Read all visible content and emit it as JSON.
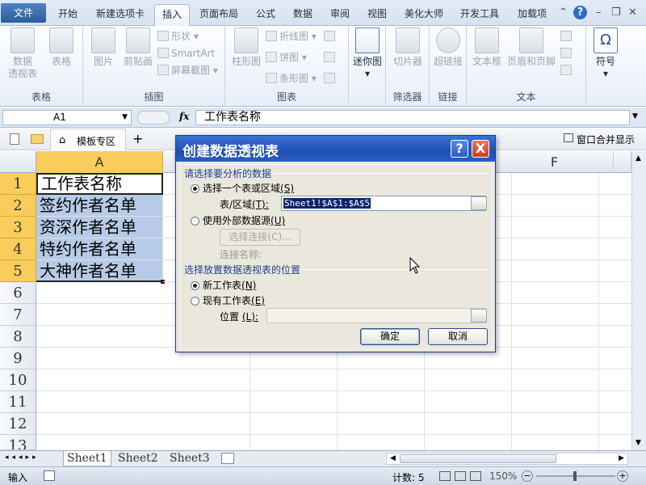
{
  "tabs": [
    "文件",
    "开始",
    "新建选项卡",
    "插入",
    "页面布局",
    "公式",
    "数据",
    "审阅",
    "视图",
    "美化大师",
    "开发工具",
    "加载项"
  ],
  "ribbon": {
    "groups": {
      "table": "表格",
      "illustrations": "插图",
      "charts": "图表",
      "sparklines": "",
      "filter": "筛选器",
      "links": "链接",
      "text": "文本"
    },
    "buttons": {
      "pivot": "数据\n透视表",
      "pivot_line1": "数据",
      "pivot_line2": "透视表",
      "table": "表格",
      "picture": "图片",
      "clipart": "剪贴画",
      "shapes": "形状",
      "smartart": "SmartArt",
      "screenshot": "屏幕截图",
      "column": "柱形图",
      "line": "折线图",
      "pie": "饼图",
      "bar": "条形图",
      "sparkline": "迷你图",
      "slicer": "切片器",
      "hyperlink": "超链接",
      "textbox": "文本框",
      "header_footer": "页眉和页脚",
      "symbol": "符号"
    }
  },
  "formula_bar": {
    "name_box": "A1",
    "fx": "fx",
    "content": "工作表名称"
  },
  "template_bar": {
    "template_zone": "模板专区",
    "add": "+",
    "window_merge": "窗口合并显示"
  },
  "grid": {
    "columns": [
      "A",
      "F"
    ],
    "rows": [
      "1",
      "2",
      "3",
      "4",
      "5",
      "6",
      "7",
      "8",
      "9",
      "10",
      "11",
      "12",
      "13"
    ],
    "cells_A": [
      "工作表名称",
      "签约作者名单",
      "资深作者名单",
      "特约作者名单",
      "大神作者名单"
    ]
  },
  "sheets": [
    "Sheet1",
    "Sheet2",
    "Sheet3"
  ],
  "status": {
    "mode": "输入",
    "count": "计数: 5",
    "zoom": "150%"
  },
  "dialog": {
    "title": "创建数据透视表",
    "help": "?",
    "close": "X",
    "section1": "请选择要分析的数据",
    "opt_table": "选择一个表或区域",
    "opt_table_key": "(S)",
    "range_label": "表/区域",
    "range_key": "(T):",
    "range_value": "Sheet1!$A$1:$A$5",
    "opt_external": "使用外部数据源",
    "opt_external_key": "(U)",
    "choose_conn": "选择连接(C)...",
    "conn_name": "连接名称:",
    "section2": "选择放置数据透视表的位置",
    "opt_new": "新工作表",
    "opt_new_key": "(N)",
    "opt_existing": "现有工作表",
    "opt_existing_key": "(E)",
    "location_label": "位置",
    "location_key": "(L):",
    "ok": "确定",
    "cancel": "取消"
  }
}
